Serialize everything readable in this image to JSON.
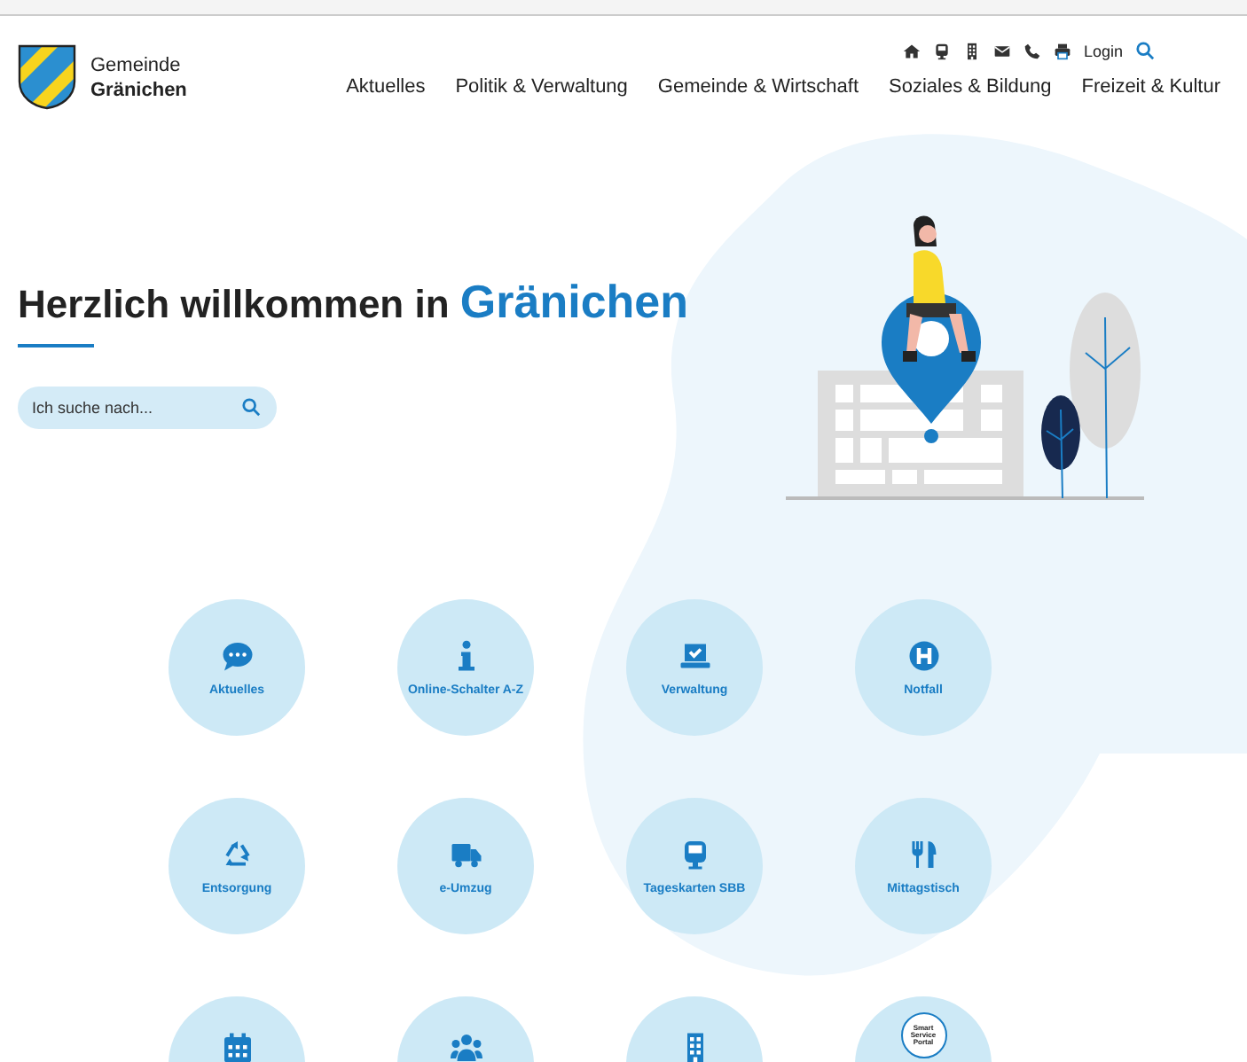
{
  "header": {
    "logo_line1": "Gemeinde",
    "logo_line2": "Gränichen",
    "login": "Login",
    "nav": [
      "Aktuelles",
      "Politik & Verwaltung",
      "Gemeinde & Wirtschaft",
      "Soziales & Bildung",
      "Freizeit & Kultur"
    ]
  },
  "hero": {
    "title": "Herzlich willkommen in",
    "title_highlight": "Gränichen",
    "search": {
      "placeholder": "Ich suche nach..."
    }
  },
  "tiles": [
    {
      "kind": "link",
      "label": "Aktuelles"
    },
    {
      "kind": "link",
      "label": "Online-Schalter A-Z"
    },
    {
      "kind": "link",
      "label": "Verwaltung"
    },
    {
      "kind": "link",
      "label": "Notfall"
    },
    {
      "kind": "link",
      "label": "Entsorgung"
    },
    {
      "kind": "link",
      "label": "e-Umzug"
    },
    {
      "kind": "link",
      "label": "Tageskarten SBB"
    },
    {
      "kind": "link",
      "label": "Mittagstisch"
    },
    {
      "kind": "icon"
    },
    {
      "kind": "icon"
    },
    {
      "kind": "icon"
    },
    {
      "kind": "portal",
      "badge": "Smart Service Portal"
    }
  ]
}
